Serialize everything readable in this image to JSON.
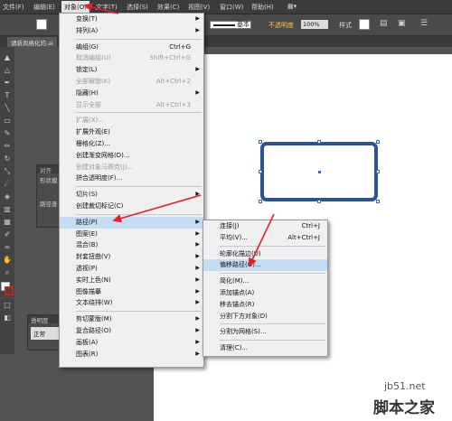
{
  "menubar": {
    "items": [
      {
        "label": "文件(F)",
        "active": false
      },
      {
        "label": "编辑(E)",
        "active": false
      },
      {
        "label": "对象(O)",
        "active": true
      },
      {
        "label": "文字(T)",
        "active": false
      },
      {
        "label": "选择(S)",
        "active": false
      },
      {
        "label": "效果(C)",
        "active": false
      },
      {
        "label": "视图(V)",
        "active": false
      },
      {
        "label": "窗口(W)",
        "active": false
      },
      {
        "label": "帮助(H)",
        "active": false
      }
    ]
  },
  "control_bar": {
    "stroke_preset": "基本",
    "opacity_label": "不透明度",
    "opacity_value": "100%",
    "style_label": "样式"
  },
  "document_tab": "请新风格化的.ai",
  "panels": {
    "align": {
      "title": "对齐",
      "rows": [
        "形状模",
        "路径查"
      ]
    },
    "transparency": {
      "title": "透明度",
      "mode": "正常"
    }
  },
  "object_menu": {
    "items": [
      {
        "label": "变换(T)",
        "shortcut": "",
        "submenu": true,
        "disabled": false
      },
      {
        "label": "排列(A)",
        "shortcut": "",
        "submenu": true,
        "disabled": false
      },
      {
        "sep": true
      },
      {
        "label": "编组(G)",
        "shortcut": "Ctrl+G",
        "submenu": false,
        "disabled": false
      },
      {
        "label": "取消编组(U)",
        "shortcut": "Shift+Ctrl+G",
        "submenu": false,
        "disabled": true
      },
      {
        "label": "锁定(L)",
        "shortcut": "",
        "submenu": true,
        "disabled": false
      },
      {
        "label": "全部解锁(K)",
        "shortcut": "Alt+Ctrl+2",
        "submenu": false,
        "disabled": true
      },
      {
        "label": "隐藏(H)",
        "shortcut": "",
        "submenu": true,
        "disabled": false
      },
      {
        "label": "显示全部",
        "shortcut": "Alt+Ctrl+3",
        "submenu": false,
        "disabled": true
      },
      {
        "sep": true
      },
      {
        "label": "扩展(X)...",
        "shortcut": "",
        "submenu": false,
        "disabled": true
      },
      {
        "label": "扩展外观(E)",
        "shortcut": "",
        "submenu": false,
        "disabled": false
      },
      {
        "label": "栅格化(Z)...",
        "shortcut": "",
        "submenu": false,
        "disabled": false
      },
      {
        "label": "创建渐变网格(D)...",
        "shortcut": "",
        "submenu": false,
        "disabled": false
      },
      {
        "label": "创建对象马赛克(J)...",
        "shortcut": "",
        "submenu": false,
        "disabled": true
      },
      {
        "label": "拼合透明度(F)...",
        "shortcut": "",
        "submenu": false,
        "disabled": false
      },
      {
        "sep": true
      },
      {
        "label": "切片(S)",
        "shortcut": "",
        "submenu": true,
        "disabled": false
      },
      {
        "label": "创建裁切标记(C)",
        "shortcut": "",
        "submenu": false,
        "disabled": false
      },
      {
        "sep": true
      },
      {
        "label": "路径(P)",
        "shortcut": "",
        "submenu": true,
        "disabled": false,
        "highlight": true
      },
      {
        "label": "图案(E)",
        "shortcut": "",
        "submenu": true,
        "disabled": false
      },
      {
        "label": "混合(B)",
        "shortcut": "",
        "submenu": true,
        "disabled": false
      },
      {
        "label": "封套扭曲(V)",
        "shortcut": "",
        "submenu": true,
        "disabled": false
      },
      {
        "label": "透视(P)",
        "shortcut": "",
        "submenu": true,
        "disabled": false
      },
      {
        "label": "实时上色(N)",
        "shortcut": "",
        "submenu": true,
        "disabled": false
      },
      {
        "label": "图像描摹",
        "shortcut": "",
        "submenu": true,
        "disabled": false
      },
      {
        "label": "文本绕排(W)",
        "shortcut": "",
        "submenu": true,
        "disabled": false
      },
      {
        "sep": true
      },
      {
        "label": "剪切蒙版(M)",
        "shortcut": "",
        "submenu": true,
        "disabled": false
      },
      {
        "label": "复合路径(O)",
        "shortcut": "",
        "submenu": true,
        "disabled": false
      },
      {
        "label": "画板(A)",
        "shortcut": "",
        "submenu": true,
        "disabled": false
      },
      {
        "label": "图表(R)",
        "shortcut": "",
        "submenu": true,
        "disabled": false
      }
    ]
  },
  "path_submenu": {
    "items": [
      {
        "label": "连接(J)",
        "shortcut": "Ctrl+J"
      },
      {
        "label": "平均(V)...",
        "shortcut": "Alt+Ctrl+J"
      },
      {
        "sep": true
      },
      {
        "label": "轮廓化描边(U)",
        "shortcut": ""
      },
      {
        "label": "偏移路径(O)...",
        "shortcut": "",
        "highlight": true
      },
      {
        "sep": true
      },
      {
        "label": "简化(M)...",
        "shortcut": ""
      },
      {
        "label": "添加锚点(A)",
        "shortcut": ""
      },
      {
        "label": "移去锚点(R)",
        "shortcut": ""
      },
      {
        "label": "分割下方对象(D)",
        "shortcut": ""
      },
      {
        "sep": true
      },
      {
        "label": "分割为网格(S)...",
        "shortcut": ""
      },
      {
        "sep": true
      },
      {
        "label": "清理(C)...",
        "shortcut": ""
      }
    ]
  },
  "watermark": {
    "line1": "jb51.net",
    "line2": "脚本之家"
  },
  "colors": {
    "accent_arrow": "#e0202a",
    "shape_stroke": "#2e5490",
    "menu_highlight": "#c6dcf2"
  }
}
